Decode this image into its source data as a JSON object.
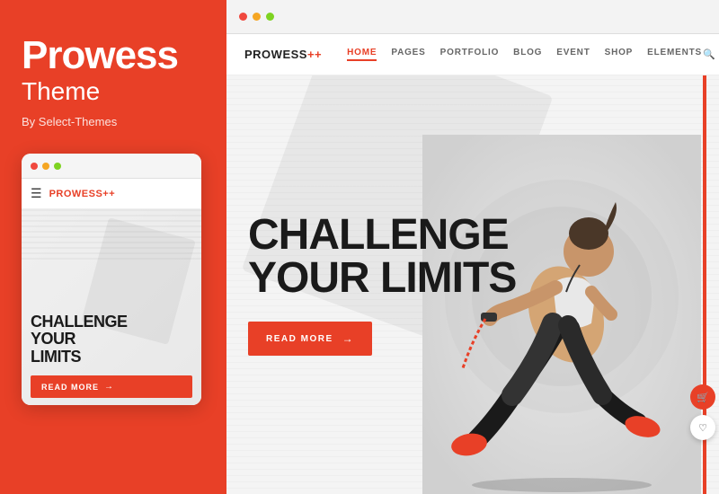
{
  "left": {
    "title": "Prowess",
    "subtitle": "Theme",
    "by": "By Select-Themes"
  },
  "mobile": {
    "logo": "PROWESS",
    "logo_plus": "++",
    "headline_line1": "CHALLENGE",
    "headline_line2": "YOUR",
    "headline_line3": "LIMITS",
    "cta_label": "READ MORE",
    "dots": [
      "red",
      "yellow",
      "green"
    ]
  },
  "browser": {
    "dots": [
      "red",
      "yellow",
      "green"
    ]
  },
  "nav": {
    "logo": "PROWESS",
    "logo_plus": "++",
    "items": [
      {
        "label": "HOME",
        "active": true
      },
      {
        "label": "PAGES",
        "active": false
      },
      {
        "label": "PORTFOLIO",
        "active": false
      },
      {
        "label": "BLOG",
        "active": false
      },
      {
        "label": "EVENT",
        "active": false
      },
      {
        "label": "SHOP",
        "active": false
      },
      {
        "label": "ELEMENTS",
        "active": false
      }
    ]
  },
  "hero": {
    "headline_line1": "CHALLENGE",
    "headline_line2": "YOUR LIMITS",
    "cta_label": "READ MORE"
  }
}
